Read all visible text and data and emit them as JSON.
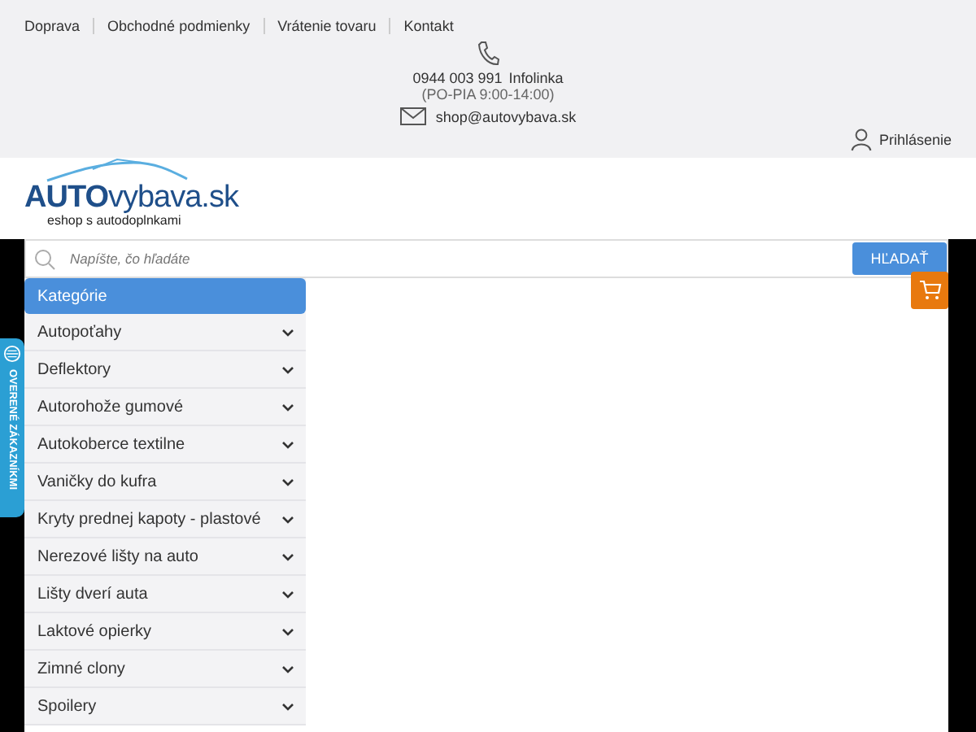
{
  "top_links": [
    "Doprava",
    "Obchodné podmienky",
    "Vrátenie tovaru",
    "Kontakt"
  ],
  "contact": {
    "phone": "0944 003 991",
    "phone_label": "Infolinka",
    "hours": "(PO-PIA 9:00-14:00)",
    "email": "shop@autovybava.sk"
  },
  "account": {
    "label": "Prihlásenie"
  },
  "logo": {
    "brand_bold": "AUTO",
    "brand_rest": "vybava.sk",
    "tagline": "eshop s autodoplnkami"
  },
  "search": {
    "placeholder": "Napíšte, čo hľadáte",
    "button": "HĽADAŤ"
  },
  "verified_badge": {
    "label": "OVERENÉ ZÁKAZNÍKMI"
  },
  "categories": {
    "title": "Kategórie",
    "items": [
      {
        "label": "Autopoťahy",
        "expanded": false
      },
      {
        "label": "Deflektory",
        "expanded": false
      },
      {
        "label": "Autorohože gumové",
        "expanded": false
      },
      {
        "label": "Autokoberce textilne",
        "expanded": false
      },
      {
        "label": "Vaničky do kufra",
        "expanded": false
      },
      {
        "label": "Kryty prednej kapoty - plastové",
        "expanded": false
      },
      {
        "label": "Nerezové lišty na auto",
        "expanded": false
      },
      {
        "label": "Lišty dverí auta",
        "expanded": false
      },
      {
        "label": "Laktové opierky",
        "expanded": false
      },
      {
        "label": "Zimné clony",
        "expanded": false
      },
      {
        "label": "Spoilery",
        "expanded": false
      }
    ]
  }
}
